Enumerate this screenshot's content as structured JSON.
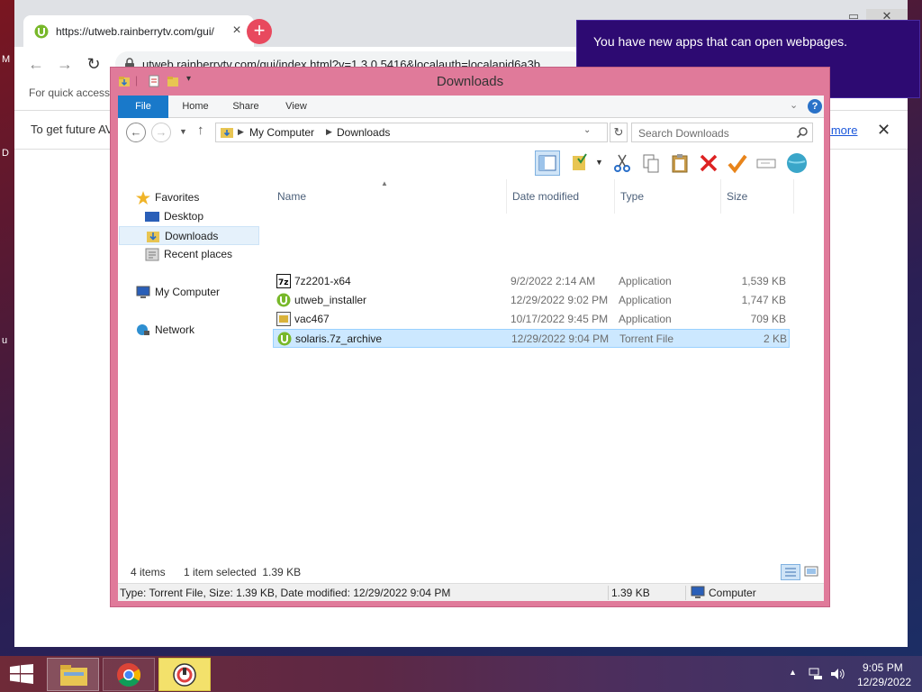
{
  "desktop": {
    "letters": [
      "M",
      "D",
      "u"
    ]
  },
  "browser": {
    "tab_title": "https://utweb.rainberrytv.com/gui/",
    "tab_close": "×",
    "new_tab": "+",
    "url": "utweb.rainberrytv.com/gui/index.html?v=1.3.0.5416&localauth=localapid6a3b",
    "bookmarks_hint": "For quick access,",
    "infobar_text": "To get future AV",
    "infobar_link": "n more",
    "infobar_close": "✕"
  },
  "toast": {
    "message": "You have new apps that can open webpages."
  },
  "explorer": {
    "title": "Downloads",
    "ribbon_tabs": [
      "File",
      "Home",
      "Share",
      "View"
    ],
    "breadcrumb": [
      "My Computer",
      "Downloads"
    ],
    "search_placeholder": "Search Downloads",
    "nav": {
      "favorites": "Favorites",
      "desktop": "Desktop",
      "downloads": "Downloads",
      "recent": "Recent places",
      "computer": "My Computer",
      "network": "Network"
    },
    "columns": [
      "Name",
      "Date modified",
      "Type",
      "Size"
    ],
    "files": [
      {
        "name": "7z2201-x64",
        "date": "9/2/2022 2:14 AM",
        "type": "Application",
        "size": "1,539 KB",
        "icon": "7zip-icon"
      },
      {
        "name": "utweb_installer",
        "date": "12/29/2022 9:02 PM",
        "type": "Application",
        "size": "1,747 KB",
        "icon": "utorrent-icon"
      },
      {
        "name": "vac467",
        "date": "10/17/2022 9:45 PM",
        "type": "Application",
        "size": "709 KB",
        "icon": "app-icon"
      },
      {
        "name": "solaris.7z_archive",
        "date": "12/29/2022 9:04 PM",
        "type": "Torrent File",
        "size": "2 KB",
        "icon": "torrent-icon",
        "selected": true
      }
    ],
    "status": {
      "count": "4 items",
      "selection": "1 item selected  1.39 KB"
    },
    "details": {
      "info": "Type: Torrent File, Size: 1.39 KB, Date modified: 12/29/2022 9:04 PM",
      "size": "1.39 KB",
      "location": "Computer"
    }
  },
  "taskbar": {
    "time": "9:05 PM",
    "date": "12/29/2022"
  }
}
